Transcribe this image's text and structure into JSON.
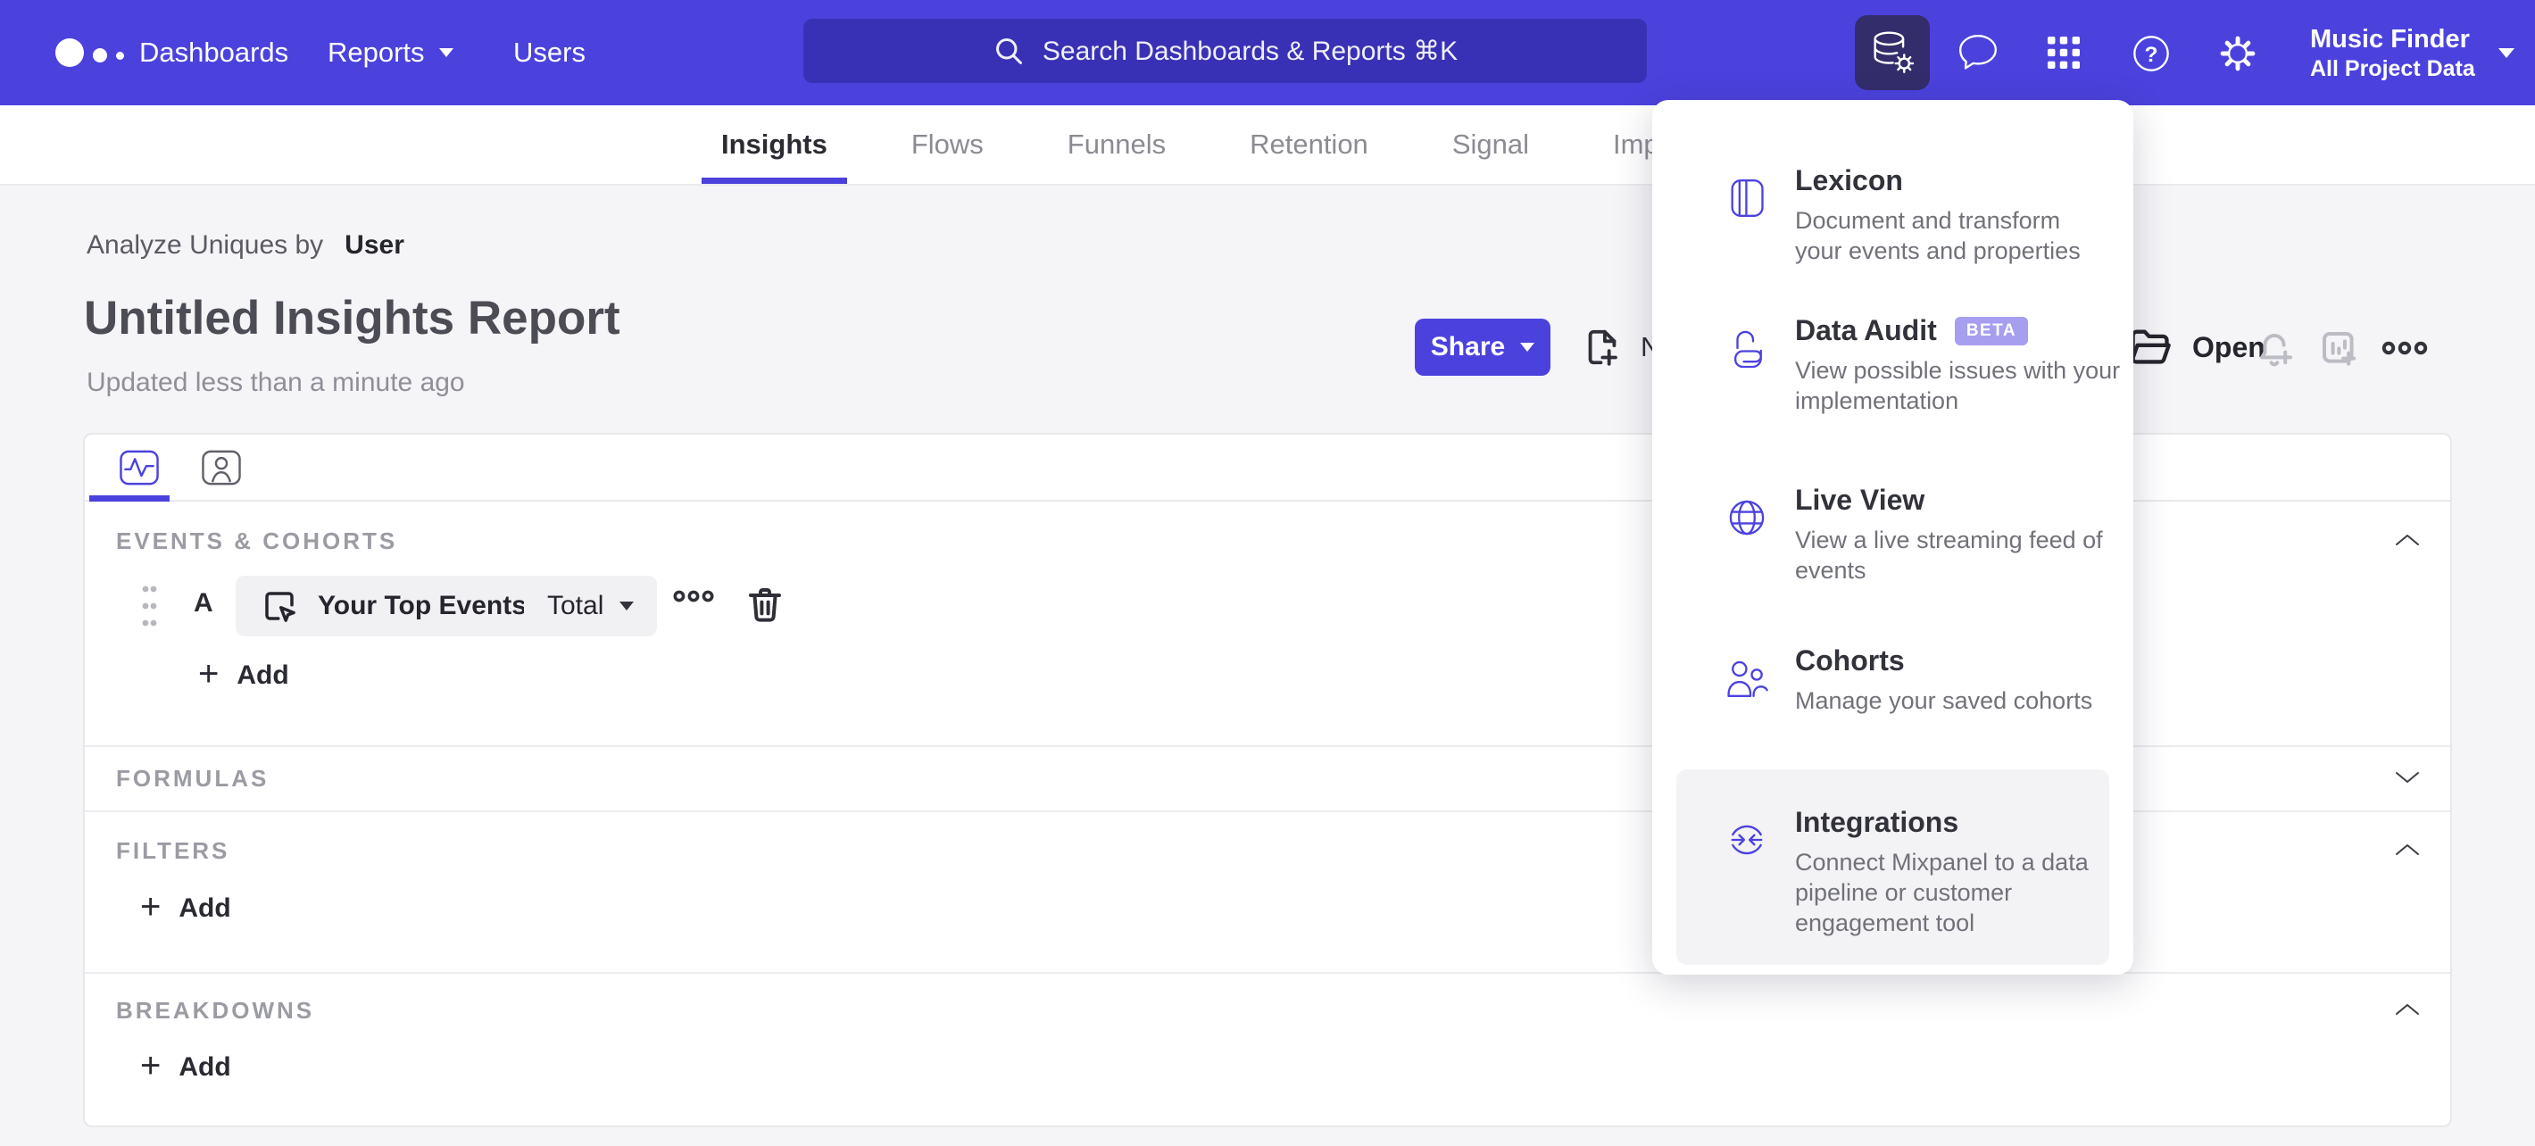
{
  "colors": {
    "nav_bg": "#4B42DD",
    "accent": "#4B42E0",
    "active_icon_bg": "#332D6B",
    "beta_badge_bg": "#A79EF0",
    "hover_item_bg": "#F3F3F5",
    "page_bg": "#F5F5F7"
  },
  "topnav": {
    "items": [
      {
        "label": "Dashboards"
      },
      {
        "label": "Reports"
      },
      {
        "label": "Users"
      }
    ],
    "search_placeholder": "Search Dashboards & Reports ⌘K",
    "icons": [
      "database-gear-icon",
      "feedback-bubble-icon",
      "apps-grid-icon",
      "help-icon",
      "settings-gear-icon"
    ],
    "project": {
      "name": "Music Finder",
      "scope": "All Project Data"
    }
  },
  "tabbar": {
    "tabs": [
      {
        "label": "Insights",
        "active": true
      },
      {
        "label": "Flows",
        "active": false
      },
      {
        "label": "Funnels",
        "active": false
      },
      {
        "label": "Retention",
        "active": false
      },
      {
        "label": "Signal",
        "active": false
      },
      {
        "label": "Impact",
        "active": false
      }
    ]
  },
  "report_header": {
    "analyze_prefix": "Analyze Uniques by",
    "analyze_entity": "User",
    "title": "Untitled Insights Report",
    "updated": "Updated less than a minute ago",
    "share_label": "Share",
    "new_label": "New",
    "open_label": "Open",
    "action_icons": [
      "file-plus-icon",
      "folder-open-icon",
      "bell-plus-icon",
      "chart-plus-icon",
      "ellipsis-icon"
    ]
  },
  "builder": {
    "tab_icons": [
      "pulse-chart-tab-icon",
      "profile-tab-icon"
    ],
    "sections": [
      {
        "label": "EVENTS & COHORTS",
        "chevron": "up"
      },
      {
        "label": "FORMULAS",
        "chevron": "down"
      },
      {
        "label": "FILTERS",
        "chevron": "up"
      },
      {
        "label": "BREAKDOWNS",
        "chevron": "up"
      }
    ],
    "event_row": {
      "series_letter": "A",
      "event_name": "Your Top Events",
      "metric": "Total"
    },
    "add_label": "Add"
  },
  "menu": {
    "items": [
      {
        "icon": "lexicon-book-icon",
        "title": "Lexicon",
        "desc": "Document and transform\nyour events and properties"
      },
      {
        "icon": "data-audit-lock-icon",
        "title": "Data Audit",
        "badge": "BETA",
        "desc": "View possible issues with your\nimplementation"
      },
      {
        "icon": "live-view-globe-icon",
        "title": "Live View",
        "desc": "View a live streaming feed of\nevents"
      },
      {
        "icon": "cohorts-people-icon",
        "title": "Cohorts",
        "desc": "Manage your saved cohorts"
      },
      {
        "icon": "integrations-sync-icon",
        "title": "Integrations",
        "desc": "Connect Mixpanel to a data\npipeline or customer\nengagement tool",
        "hovered": true
      }
    ]
  }
}
